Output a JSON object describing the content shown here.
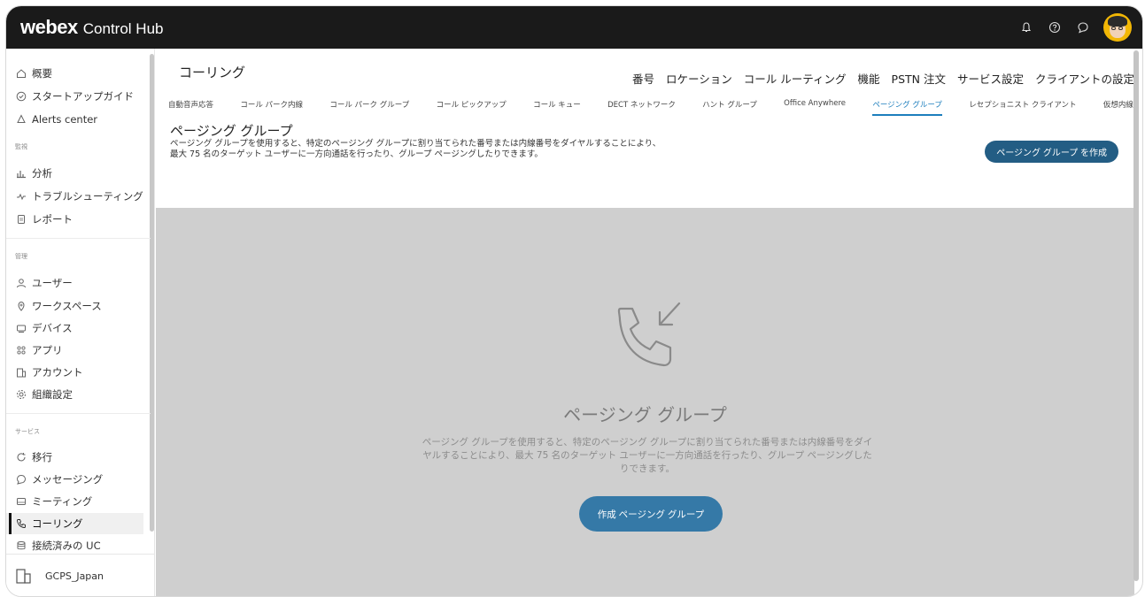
{
  "app": {
    "brand_main": "webex",
    "brand_sub": "Control Hub"
  },
  "sidebar": {
    "items_top": [
      {
        "label": "概要",
        "icon": "home-icon"
      },
      {
        "label": "スタートアップガイド",
        "icon": "check-circle-icon"
      },
      {
        "label": "Alerts center",
        "icon": "bell-icon"
      }
    ],
    "section_monitor": "監視",
    "items_monitor": [
      {
        "label": "分析",
        "icon": "bar-chart-icon"
      },
      {
        "label": "トラブルシューティング",
        "icon": "pulse-icon"
      },
      {
        "label": "レポート",
        "icon": "report-icon"
      }
    ],
    "section_manage": "管理",
    "items_manage": [
      {
        "label": "ユーザー",
        "icon": "user-icon"
      },
      {
        "label": "ワークスペース",
        "icon": "location-icon"
      },
      {
        "label": "デバイス",
        "icon": "device-icon"
      },
      {
        "label": "アプリ",
        "icon": "apps-icon"
      },
      {
        "label": "アカウント",
        "icon": "building-icon"
      },
      {
        "label": "組織設定",
        "icon": "gear-icon"
      }
    ],
    "section_services": "サービス",
    "items_services": [
      {
        "label": "移行",
        "icon": "refresh-icon"
      },
      {
        "label": "メッセージング",
        "icon": "chat-icon"
      },
      {
        "label": "ミーティング",
        "icon": "meeting-icon"
      },
      {
        "label": "コーリング",
        "icon": "phone-icon"
      },
      {
        "label": "接続済みの UC",
        "icon": "database-icon"
      }
    ],
    "org_name": "GCPS_Japan"
  },
  "main": {
    "title": "コーリング",
    "top_tabs": [
      "番号",
      "ロケーション",
      "コール ルーティング",
      "機能",
      "PSTN 注文",
      "サービス設定",
      "クライアントの設定"
    ],
    "sub_tabs": [
      "自動音声応答",
      "コール パーク内線",
      "コール パーク グループ",
      "コール ピックアップ",
      "コール キュー",
      "DECT ネットワーク",
      "ハント グループ",
      "Office Anywhere",
      "ページング グループ",
      "レセプショニスト クライアント",
      "仮想内線"
    ],
    "active_sub_tab": 8,
    "section_title": "ページング グループ",
    "section_desc": "ページング グループを使用すると、特定のページング グループに割り当てられた番号または内線番号をダイヤルすることにより、最大 75 名のターゲット ユーザーに一方向通話を行ったり、グループ ページングしたりできます。",
    "create_button": "ページング グループ を作成",
    "empty": {
      "title": "ページング グループ",
      "desc": "ページング グループを使用すると、特定のページング グループに割り当てられた番号または内線番号をダイヤルすることにより、最大 75 名のターゲット ユーザーに一方向通話を行ったり、グループ ページングしたりできます。",
      "button": "作成 ページング グループ"
    }
  },
  "colors": {
    "accent": "#1d7ebd",
    "button_dark": "#235d84",
    "button_primary": "#3579a7",
    "topbar": "#1a1a1a",
    "empty_bg": "#cfcfcf"
  }
}
